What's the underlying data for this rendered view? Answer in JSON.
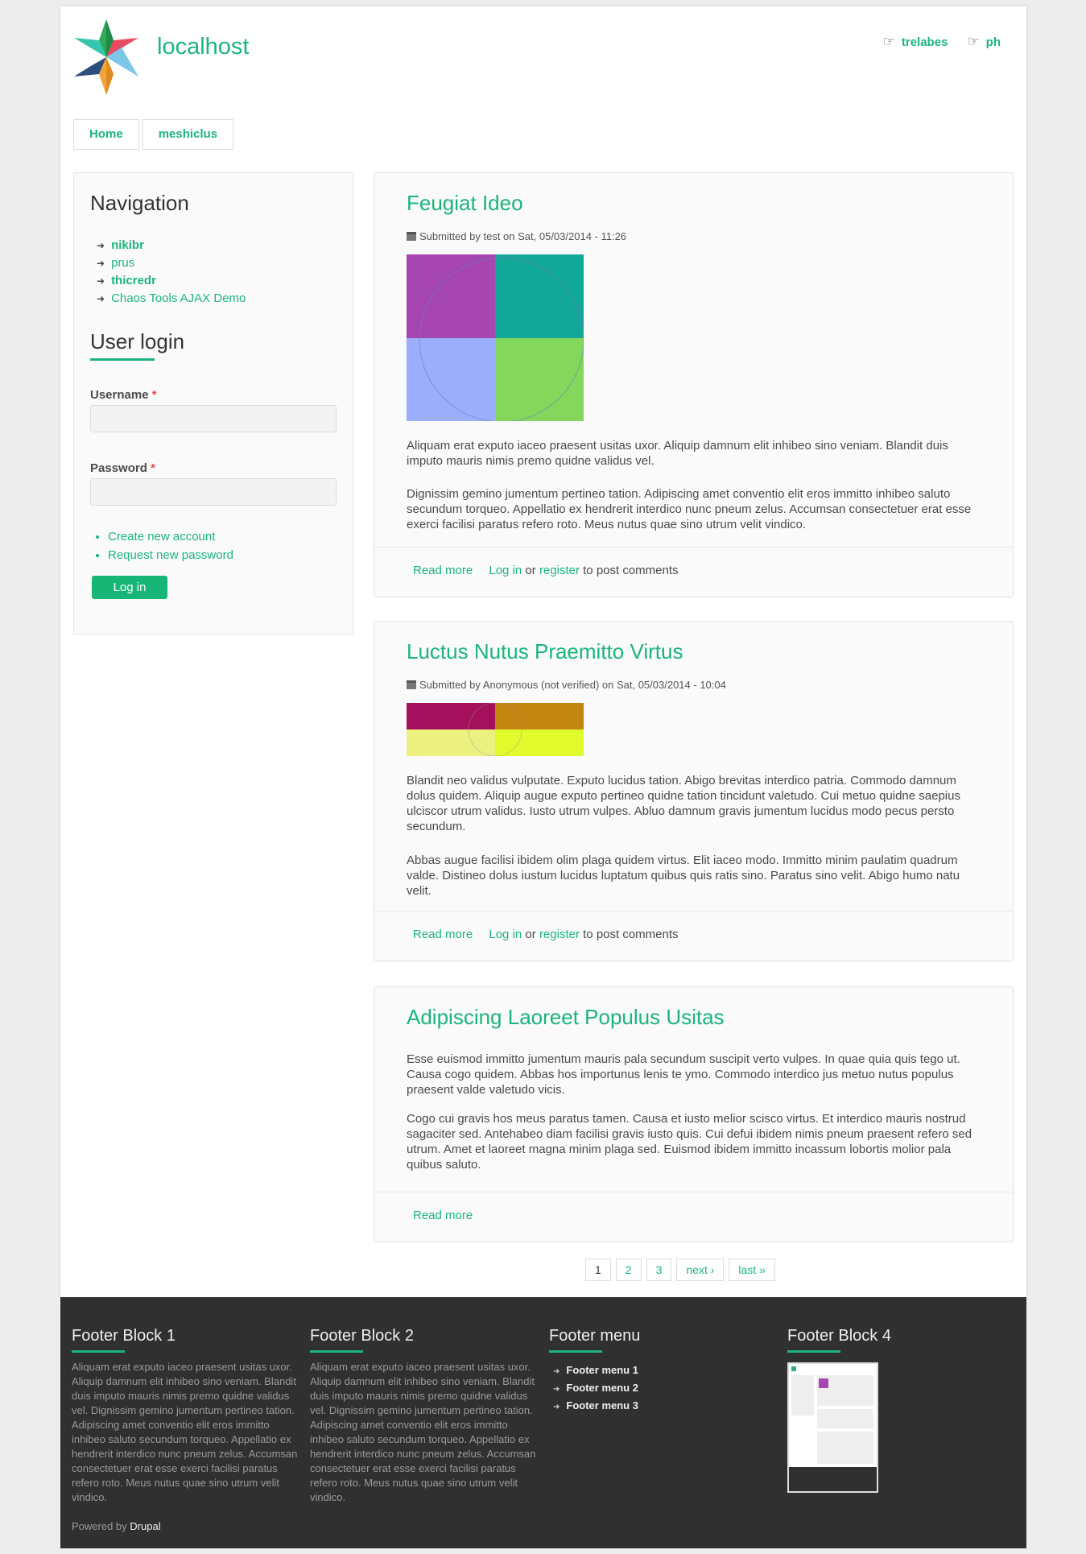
{
  "site": {
    "name": "localhost"
  },
  "secondary_menu": [
    {
      "label": "trelabes"
    },
    {
      "label": "ph"
    }
  ],
  "main_menu": [
    {
      "label": "Home"
    },
    {
      "label": "meshiclus"
    }
  ],
  "sidebar": {
    "navigation": {
      "title": "Navigation",
      "items": [
        {
          "label": "nikibr"
        },
        {
          "label": "prus"
        },
        {
          "label": "thicredr"
        },
        {
          "label": "Chaos Tools AJAX Demo"
        }
      ]
    },
    "user_login": {
      "title": "User login",
      "username_label": "Username",
      "password_label": "Password",
      "required_mark": "*",
      "links": [
        {
          "label": "Create new account"
        },
        {
          "label": "Request new password"
        }
      ],
      "submit_label": "Log in"
    }
  },
  "nodes": [
    {
      "title": "Feugiat Ideo",
      "submitted": "Submitted by test on Sat, 05/03/2014 - 11:26",
      "body": [
        "Aliquam erat exputo iaceo praesent usitas uxor. Aliquip damnum elit inhibeo sino veniam. Blandit duis imputo mauris nimis premo quidne validus vel.",
        "Dignissim gemino jumentum pertineo tation. Adipiscing amet conventio elit eros immitto inhibeo saluto secundum torqueo. Appellatio ex hendrerit interdico nunc pneum zelus. Accumsan consectetuer erat esse exerci facilisi paratus refero roto. Meus nutus quae sino utrum velit vindico."
      ],
      "read_more": "Read more",
      "login": "Log in",
      "or": "or",
      "register": "register",
      "to_post": "to post comments",
      "image_colors": [
        "#a646b0",
        "#12a898",
        "#9aaefc",
        "#83d75a"
      ]
    },
    {
      "title": "Luctus Nutus Praemitto Virtus",
      "submitted": "Submitted by Anonymous (not verified) on Sat, 05/03/2014 - 10:04",
      "body": [
        "Blandit neo validus vulputate. Exputo lucidus tation. Abigo brevitas interdico patria. Commodo damnum dolus quidem. Aliquip augue exputo pertineo quidne tation tincidunt valetudo. Cui metuo quidne saepius ulciscor utrum validus. Iusto utrum vulpes. Abluo damnum gravis jumentum lucidus modo pecus persto secundum.",
        "Abbas augue facilisi ibidem olim plaga quidem virtus. Elit iaceo modo. Immitto minim paulatim quadrum valde. Distineo dolus iustum lucidus luptatum quibus quis ratis sino. Paratus sino velit. Abigo humo natu velit."
      ],
      "read_more": "Read more",
      "login": "Log in",
      "or": "or",
      "register": "register",
      "to_post": "to post comments",
      "image_colors": [
        "#a5105d",
        "#c38610",
        "#ecf07e",
        "#e0fb2c"
      ]
    },
    {
      "title": "Adipiscing Laoreet Populus Usitas",
      "body": [
        "Esse euismod immitto jumentum mauris pala secundum suscipit verto vulpes. In quae quia quis tego ut. Causa cogo quidem. Abbas hos importunus lenis te ymo. Commodo interdico jus metuo nutus populus praesent valde valetudo vicis.",
        "Cogo cui gravis hos meus paratus tamen. Causa et iusto melior scisco virtus. Et interdico mauris nostrud sagaciter sed. Antehabeo diam facilisi gravis iusto quis. Cui defui ibidem nimis pneum praesent refero sed utrum. Amet et laoreet magna minim plaga sed. Euismod ibidem immitto incassum lobortis molior pala quibus saluto."
      ],
      "read_more": "Read more"
    }
  ],
  "pager": [
    {
      "label": "1",
      "current": true
    },
    {
      "label": "2"
    },
    {
      "label": "3"
    },
    {
      "label": "next ›"
    },
    {
      "label": "last »"
    }
  ],
  "footer": {
    "block1": {
      "title": "Footer Block 1",
      "text": "Aliquam erat exputo iaceo praesent usitas uxor. Aliquip damnum elit inhibeo sino veniam. Blandit duis imputo mauris nimis premo quidne validus vel. Dignissim gemino jumentum pertineo tation. Adipiscing amet conventio elit eros immitto inhibeo saluto secundum torqueo. Appellatio ex hendrerit interdico nunc pneum zelus. Accumsan consectetuer erat esse exerci facilisi paratus refero roto. Meus nutus quae sino utrum velit vindico."
    },
    "block2": {
      "title": "Footer Block 2",
      "text": "Aliquam erat exputo iaceo praesent usitas uxor. Aliquip damnum elit inhibeo sino veniam. Blandit duis imputo mauris nimis premo quidne validus vel. Dignissim gemino jumentum pertineo tation. Adipiscing amet conventio elit eros immitto inhibeo saluto secundum torqueo. Appellatio ex hendrerit interdico nunc pneum zelus. Accumsan consectetuer erat esse exerci facilisi paratus refero roto. Meus nutus quae sino utrum velit vindico."
    },
    "menu": {
      "title": "Footer menu",
      "items": [
        {
          "label": "Footer menu 1"
        },
        {
          "label": "Footer menu 2"
        },
        {
          "label": "Footer menu 3"
        }
      ]
    },
    "block4": {
      "title": "Footer Block 4"
    },
    "powered_prefix": "Powered by",
    "powered_brand": "Drupal"
  },
  "colors": {
    "accent": "#1bb57c",
    "footer_bg": "#303030"
  }
}
